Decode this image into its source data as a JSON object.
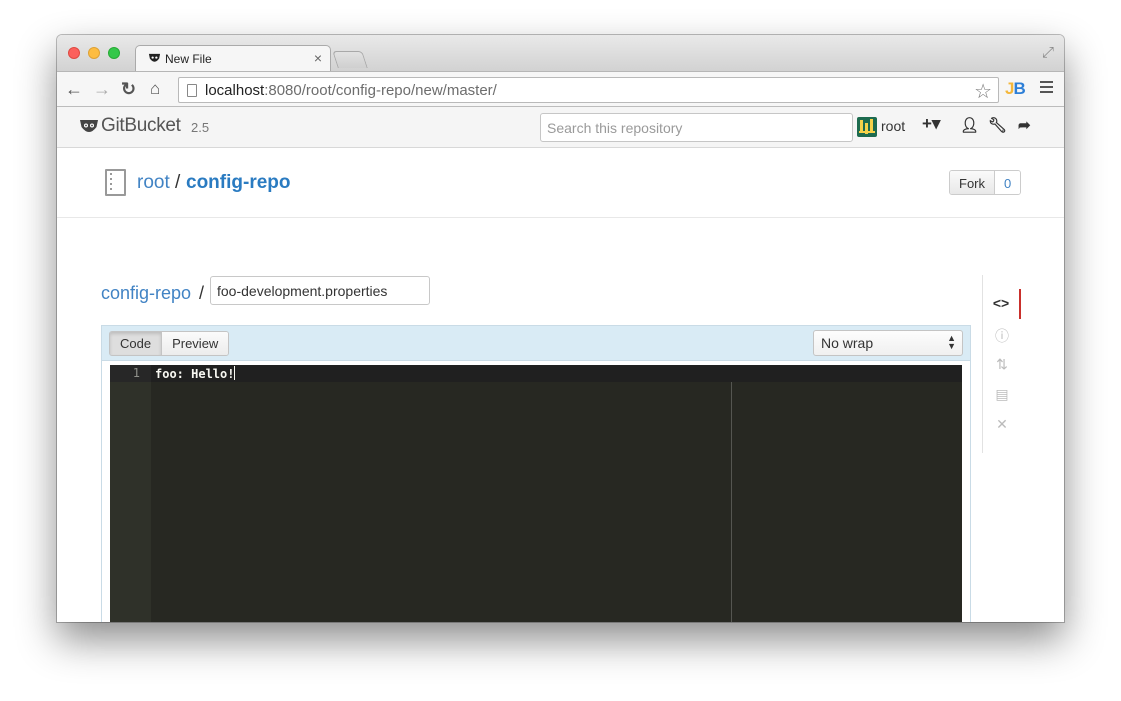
{
  "browser": {
    "tab_title": "New File",
    "tab_close": "×",
    "url_host": "localhost",
    "url_rest": ":8080/root/config-repo/new/master/",
    "extension_label_j": "J",
    "extension_label_b": "B"
  },
  "header": {
    "brand": "GitBucket",
    "version": "2.5",
    "search_placeholder": "Search this repository",
    "username": "root"
  },
  "repo": {
    "owner": "root",
    "separator": "/",
    "name": "config-repo",
    "fork_label": "Fork",
    "fork_count": "0"
  },
  "editor": {
    "path_repo": "config-repo",
    "path_separator": "/",
    "file_name": "foo-development.properties",
    "tabs": [
      "Code",
      "Preview"
    ],
    "wrap_mode": "No wrap",
    "line_number": "1",
    "line_text": "foo: Hello!"
  },
  "side_nav": [
    "code-icon",
    "issues-icon",
    "pull-requests-icon",
    "wiki-icon",
    "settings-icon"
  ],
  "colors": {
    "link": "#4183c4",
    "editor_bg": "#272822",
    "editor_head_bg": "#d9ebf5",
    "active_marker": "#c9302c"
  }
}
